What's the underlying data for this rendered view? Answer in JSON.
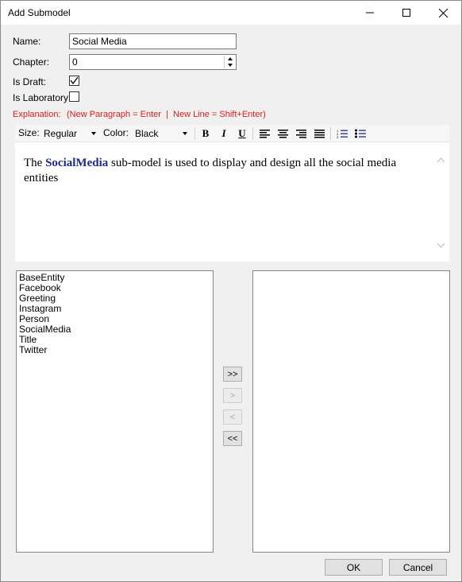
{
  "window": {
    "title": "Add Submodel"
  },
  "form": {
    "name_label": "Name:",
    "name_value": "Social Media",
    "chapter_label": "Chapter:",
    "chapter_value": "0",
    "is_draft_label": "Is Draft:",
    "is_draft_checked": true,
    "is_laboratory_label": "Is Laboratory:",
    "is_laboratory_checked": false,
    "explanation_label": "Explanation:",
    "explanation_hint": "(New Paragraph = Enter  |  New Line = Shift+Enter)"
  },
  "toolbar": {
    "size_label": "Size:",
    "size_value": "Regular",
    "color_label": "Color:",
    "color_value": "Black",
    "bold": "B",
    "italic": "I",
    "underline": "U"
  },
  "editor": {
    "prefix": "The ",
    "keyword": "SocialMedia",
    "suffix": " sub-model is used to display and design all the social media entities"
  },
  "available_list": [
    "BaseEntity",
    "Facebook",
    "Greeting",
    "Instagram",
    "Person",
    "SocialMedia",
    "Title",
    "Twitter"
  ],
  "selected_list": [],
  "move_buttons": {
    "add_all": ">>",
    "add_one": ">",
    "remove_one": "<",
    "remove_all": "<<"
  },
  "footer": {
    "ok": "OK",
    "cancel": "Cancel"
  },
  "colors": {
    "hint_red": "#e01c1c",
    "keyword_blue": "#1c2a8c"
  }
}
